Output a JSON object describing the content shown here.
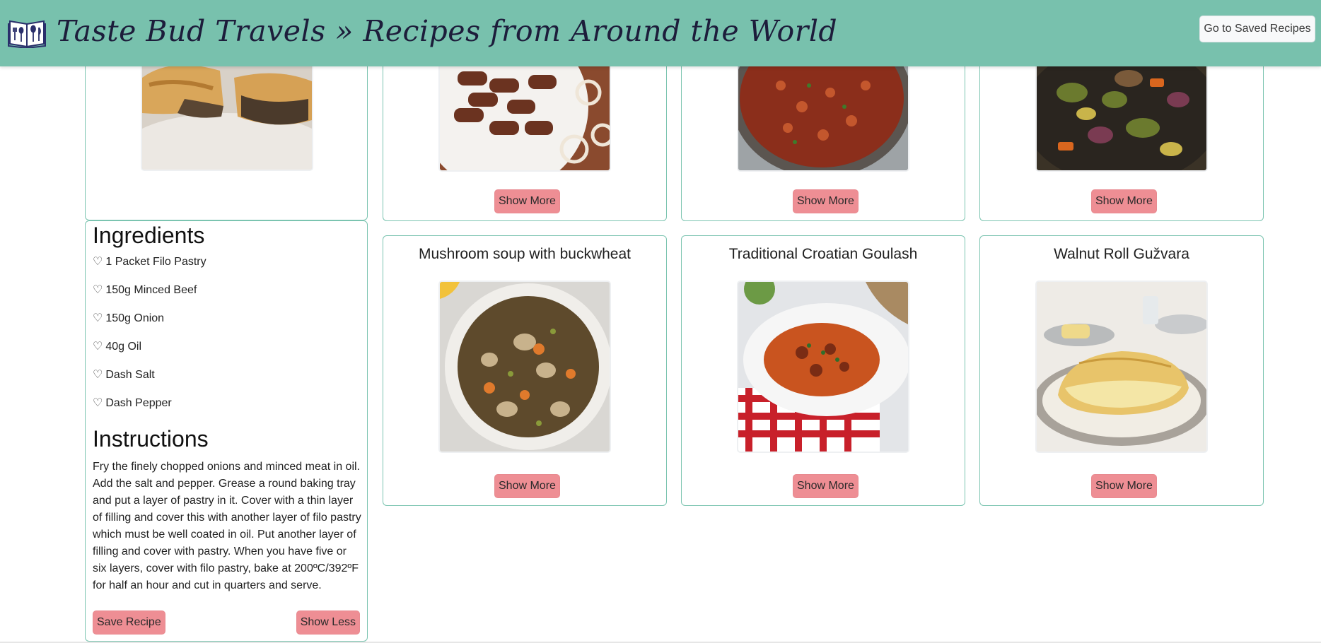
{
  "header": {
    "title": "Taste Bud Travels » Recipes from Around the World",
    "saved_button": "Go to Saved Recipes",
    "logo_icon": "recipe-book-icon",
    "background_color": "#78c1ad"
  },
  "expanded_recipe": {
    "ingredients_heading": "Ingredients",
    "ingredients": [
      "1 Packet Filo Pastry",
      "150g Minced Beef",
      "150g Onion",
      "40g Oil",
      "Dash Salt",
      "Dash Pepper"
    ],
    "bullet_icon": "heart-outline-icon",
    "bullet_glyph": "♡",
    "instructions_heading": "Instructions",
    "instructions": "Fry the finely chopped onions and minced meat in oil. Add the salt and pepper. Grease a round baking tray and put a layer of pastry in it. Cover with a thin layer of filling and cover this with another layer of filo pastry which must be well coated in oil. Put another layer of filling and cover with pastry. When you have five or six layers, cover with filo pastry, bake at 200ºC/392ºF for half an hour and cut in quarters and serve.",
    "save_button": "Save Recipe",
    "show_less_button": "Show Less"
  },
  "recipe_cards": [
    {
      "title": "",
      "image": "cevapi-dish-photo",
      "button": "Show More"
    },
    {
      "title": "",
      "image": "bean-stew-pan-photo",
      "button": "Show More"
    },
    {
      "title": "",
      "image": "roasted-vegetables-pan-photo",
      "button": "Show More"
    },
    {
      "title": "Mushroom soup with buckwheat",
      "image": "mushroom-soup-photo",
      "button": "Show More"
    },
    {
      "title": "Traditional Croatian Goulash",
      "image": "goulash-photo",
      "button": "Show More"
    },
    {
      "title": "Walnut Roll Gužvara",
      "image": "walnut-roll-photo",
      "button": "Show More"
    }
  ],
  "colors": {
    "accent": "#78c1ad",
    "card_border": "#7bc4b0",
    "button_pink": "#ee8e94"
  }
}
